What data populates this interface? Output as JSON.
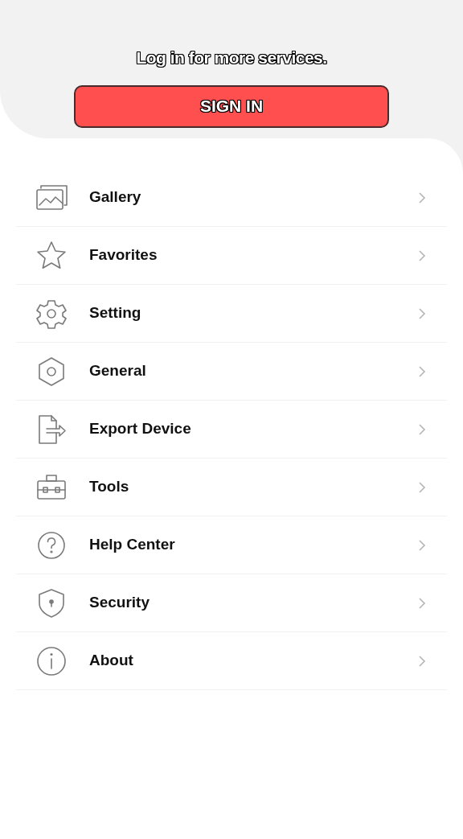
{
  "header": {
    "message": "Log in for more services.",
    "button": "SIGN IN"
  },
  "menu": [
    {
      "kind": "gallery",
      "label": "Gallery"
    },
    {
      "kind": "star",
      "label": "Favorites"
    },
    {
      "kind": "gear",
      "label": "Setting"
    },
    {
      "kind": "hexagon",
      "label": "General"
    },
    {
      "kind": "export",
      "label": "Export Device"
    },
    {
      "kind": "toolbox",
      "label": "Tools"
    },
    {
      "kind": "help",
      "label": "Help Center"
    },
    {
      "kind": "shield",
      "label": "Security"
    },
    {
      "kind": "info",
      "label": "About"
    }
  ]
}
